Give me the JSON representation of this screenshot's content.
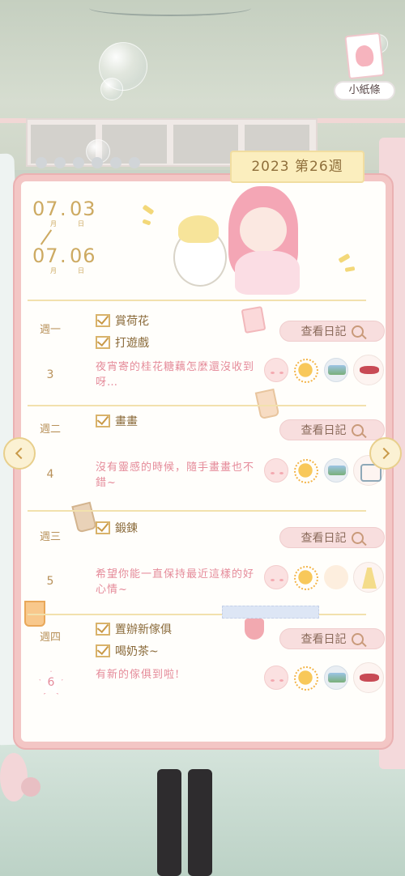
{
  "corner_note": {
    "label": "小紙條",
    "icon": "paper-note-icon"
  },
  "week_tag": "2023 第26週",
  "date_range": {
    "start": {
      "month": "07",
      "day": "03",
      "month_suffix": "月",
      "day_suffix": "日"
    },
    "end": {
      "month": "07",
      "day": "06",
      "month_suffix": "月",
      "day_suffix": "日"
    }
  },
  "view_diary_label": "查看日記",
  "days": [
    {
      "weekday": "週一",
      "number": "3",
      "tasks": [
        "賞荷花",
        "打遊戲"
      ],
      "note": "夜宵寄的桂花糖藕怎麼還沒收到呀…",
      "icons": [
        "mood-icon",
        "sun-icon",
        "photo-icon",
        "bow-item-icon"
      ]
    },
    {
      "weekday": "週二",
      "number": "4",
      "tasks": [
        "畫畫"
      ],
      "note": "沒有靈感的時候，隨手畫畫也不錯~",
      "icons": [
        "mood-icon",
        "sun-icon",
        "photo-icon",
        "shoes-item-icon"
      ]
    },
    {
      "weekday": "週三",
      "number": "5",
      "tasks": [
        "鍛鍊"
      ],
      "note": "希望你能一直保持最近這樣的好心情~",
      "icons": [
        "mood-icon",
        "sun-icon",
        "ice-cream-icon",
        "dress-item-icon"
      ]
    },
    {
      "weekday": "週四",
      "number": "6",
      "tasks": [
        "置辦新傢俱",
        "喝奶茶~"
      ],
      "note": "有新的傢俱到啦!",
      "icons": [
        "mood-icon",
        "sun-icon",
        "photo-icon",
        "bow-item-icon"
      ]
    }
  ],
  "colors": {
    "notebook_border": "#f3c6c5",
    "gold_text": "#b8915a",
    "note_pink": "#e58b9a",
    "tag_yellow": "#fbeebe"
  }
}
